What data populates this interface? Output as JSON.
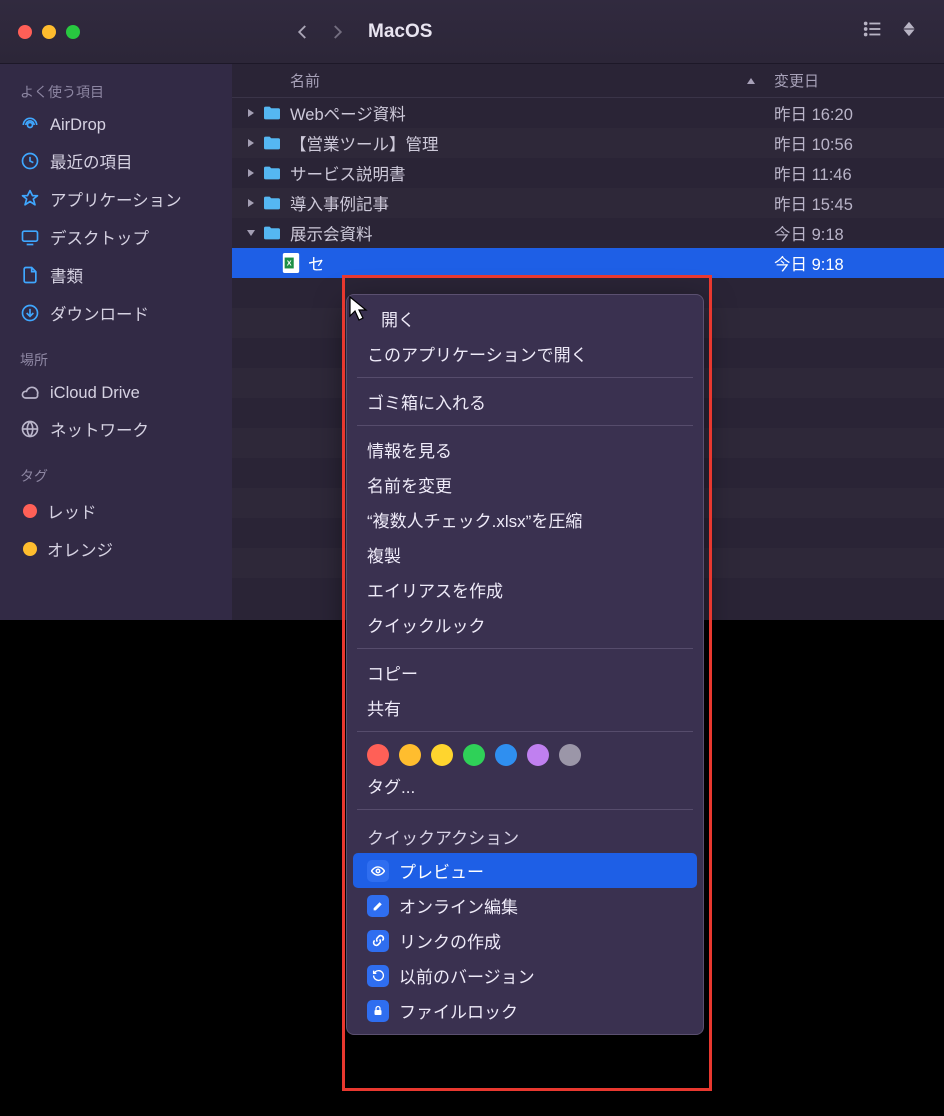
{
  "toolbar": {
    "title": "MacOS"
  },
  "sidebar": {
    "sections": [
      {
        "label": "よく使う項目",
        "items": [
          {
            "icon": "airdrop",
            "label": "AirDrop"
          },
          {
            "icon": "recent",
            "label": "最近の項目"
          },
          {
            "icon": "apps",
            "label": "アプリケーション"
          },
          {
            "icon": "desktop",
            "label": "デスクトップ"
          },
          {
            "icon": "docs",
            "label": "書類"
          },
          {
            "icon": "download",
            "label": "ダウンロード"
          }
        ]
      },
      {
        "label": "場所",
        "items": [
          {
            "icon": "cloud",
            "label": "iCloud Drive"
          },
          {
            "icon": "network",
            "label": "ネットワーク"
          }
        ]
      },
      {
        "label": "タグ",
        "items": [
          {
            "icon": "tag-red",
            "label": "レッド"
          },
          {
            "icon": "tag-orange",
            "label": "オレンジ"
          }
        ]
      }
    ]
  },
  "columns": {
    "name": "名前",
    "date": "変更日"
  },
  "files": [
    {
      "disclosure": "right",
      "name": "Webページ資料",
      "date": "昨日 16:20"
    },
    {
      "disclosure": "right",
      "name": "【営業ツール】管理",
      "date": "昨日 10:56"
    },
    {
      "disclosure": "right",
      "name": "サービス説明書",
      "date": "昨日 11:46"
    },
    {
      "disclosure": "right",
      "name": "導入事例記事",
      "date": "昨日 15:45"
    },
    {
      "disclosure": "down",
      "name": "展示会資料",
      "date": "今日 9:18"
    }
  ],
  "selected_file": {
    "name_visible": "セ",
    "date": "今日 9:18"
  },
  "context_menu": {
    "open": "開く",
    "open_with": "このアプリケーションで開く",
    "trash": "ゴミ箱に入れる",
    "info": "情報を見る",
    "rename": "名前を変更",
    "compress": "“複数人チェック.xlsx”を圧縮",
    "duplicate": "複製",
    "alias": "エイリアスを作成",
    "quicklook": "クイックルック",
    "copy": "コピー",
    "share": "共有",
    "tags_label": "タグ...",
    "quick_actions_label": "クイックアクション",
    "qa_preview": "プレビュー",
    "qa_online_edit": "オンライン編集",
    "qa_create_link": "リンクの作成",
    "qa_prev_version": "以前のバージョン",
    "qa_file_lock": "ファイルロック",
    "tag_colors": [
      "#ff6057",
      "#ffbd2e",
      "#ffd52e",
      "#2fd158",
      "#2f8ff0",
      "#c080f0",
      "#9b96a8"
    ]
  }
}
